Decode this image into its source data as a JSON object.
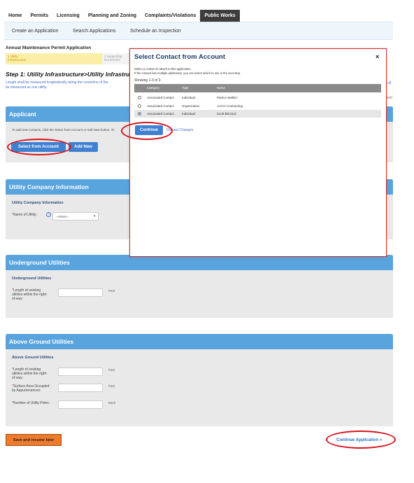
{
  "top_nav": {
    "items": [
      "Home",
      "Permits",
      "Licensing",
      "Planning and Zoning",
      "Complaints/Violations",
      "Public Works"
    ],
    "active": "Public Works"
  },
  "sub_nav": {
    "items": [
      "Create an Application",
      "Search Applications",
      "Schedule an Inspection"
    ]
  },
  "page": {
    "title": "Annual Maintenance Permit Application",
    "steps": [
      {
        "label": "1 Utility Infrastructure"
      },
      {
        "label": "2 Supporting Documents"
      }
    ],
    "step_title": "Step 1: Utility Infrastructure>Utility Infrastructu",
    "step_desc_line1": "Length shall be measured longitudinally along the centerline of the",
    "step_desc_line2": "be measured as one utility.",
    "step_desc_right": "ull",
    "required_right": "ield"
  },
  "applicant": {
    "header": "Applicant",
    "instructions": "To add new contacts, click the Select from Account or Add New button. To",
    "select_button": "Select from Account",
    "add_new_button": "Add New"
  },
  "utility_company": {
    "header": "Utility Company Information",
    "sub": "Utility Company Information",
    "name_label": "Name of Utility:",
    "select_value": "--Select--"
  },
  "underground": {
    "header": "Underground Utilities",
    "sub": "Underground Utilities",
    "length_label": "Length of existing utilities within the right-of-way:",
    "length_unit": "Feet"
  },
  "above_ground": {
    "header": "Above Ground Utilities",
    "sub": "Above Ground Utilities",
    "length_label": "Length of existing utilities within the right-of-way:",
    "length_unit": "Feet",
    "surface_label": "Surface Area Occupied by Appurtenances:",
    "surface_unit": "Feet",
    "poles_label": "Number of Utility Poles:",
    "poles_unit": "Each"
  },
  "footer": {
    "save_button": "Save and resume later",
    "continue_link": "Continue Application »"
  },
  "modal": {
    "title": "Select Contact from Account",
    "close": "×",
    "note1": "Select a contact to attach to this application.",
    "note2": "If the contact has multiple addresses, you can select which to use in the next step.",
    "count": "Showing 1-3 of 3",
    "columns": [
      "Category",
      "Type",
      "Name"
    ],
    "rows": [
      {
        "category": "Associated Contact",
        "type": "Individual",
        "name": "Patrice Walker",
        "selected": false
      },
      {
        "category": "Associated Contact",
        "type": "Organization",
        "name": "AACO Contracting",
        "selected": false
      },
      {
        "category": "Associated Contact",
        "type": "Individual",
        "name": "Scott Blizzard",
        "selected": true
      }
    ],
    "continue_button": "Continue",
    "discard_link": "Discard Changes"
  },
  "colors": {
    "section_header": "#5aa4de",
    "active_tab": "#3d3d3d",
    "button_blue": "#3f80d0",
    "button_orange": "#ee7a2c",
    "highlight_ring": "#d8121b"
  }
}
